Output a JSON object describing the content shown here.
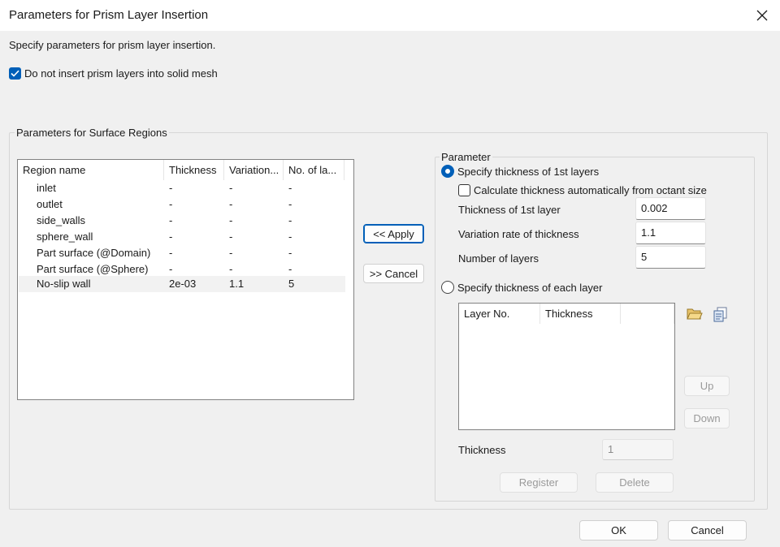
{
  "window": {
    "title": "Parameters for Prism Layer Insertion"
  },
  "description": "Specify parameters for prism layer insertion.",
  "no_solid_mesh_checkbox": {
    "label": "Do not insert prism layers into solid mesh",
    "checked": true
  },
  "surface_regions": {
    "group_label": "Parameters for Surface Regions",
    "columns": [
      "Region name",
      "Thickness",
      "Variation...",
      "No. of la..."
    ],
    "rows": [
      {
        "name": "inlet",
        "thickness": "-",
        "variation": "-",
        "layers": "-"
      },
      {
        "name": "outlet",
        "thickness": "-",
        "variation": "-",
        "layers": "-"
      },
      {
        "name": "side_walls",
        "thickness": "-",
        "variation": "-",
        "layers": "-"
      },
      {
        "name": "sphere_wall",
        "thickness": "-",
        "variation": "-",
        "layers": "-"
      },
      {
        "name": "Part surface (@Domain)",
        "thickness": "-",
        "variation": "-",
        "layers": "-"
      },
      {
        "name": "Part surface (@Sphere)",
        "thickness": "-",
        "variation": "-",
        "layers": "-"
      },
      {
        "name": "No-slip wall",
        "thickness": "2e-03",
        "variation": "1.1",
        "layers": "5"
      }
    ]
  },
  "apply_button": "<< Apply",
  "cancel_apply_button": ">> Cancel",
  "parameter": {
    "group_label": "Parameter",
    "first_layer_radio": {
      "label": "Specify thickness of 1st layers",
      "checked": true
    },
    "auto_calc_checkbox": {
      "label": "Calculate thickness automatically from octant size",
      "checked": false
    },
    "thickness_first": {
      "label": "Thickness of 1st layer",
      "value": "0.002"
    },
    "variation_rate": {
      "label": "Variation rate of thickness",
      "value": "1.1"
    },
    "num_layers": {
      "label": "Number of layers",
      "value": "5"
    },
    "each_layer_radio": {
      "label": "Specify thickness of each layer",
      "checked": false
    },
    "layer_table": {
      "columns": [
        "Layer No.",
        "Thickness"
      ]
    },
    "up_button": "Up",
    "down_button": "Down",
    "thickness_label": "Thickness",
    "thickness_value": "1",
    "register_button": "Register",
    "delete_button": "Delete"
  },
  "ok_button": "OK",
  "cancel_button": "Cancel",
  "colors": {
    "accent": "#005fb8",
    "window_bg": "#f0f0f0",
    "title_bg": "#ffffff"
  },
  "icons": {
    "close": "close-icon",
    "check": "checkmark-icon",
    "open": "folder-open-icon",
    "copy": "copy-icon"
  }
}
